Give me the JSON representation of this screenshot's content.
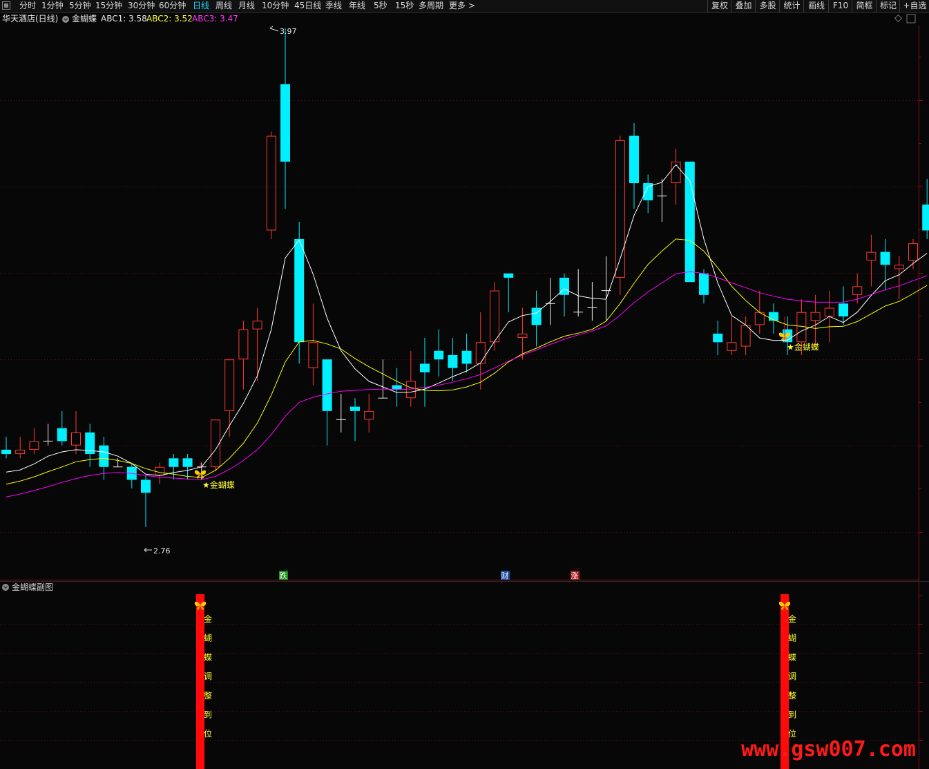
{
  "toolbar": {
    "tabs": [
      "分时",
      "1分钟",
      "5分钟",
      "15分钟",
      "30分钟",
      "60分钟",
      "日线",
      "周线",
      "月线",
      "10分钟",
      "45日线",
      "季线",
      "年线",
      "5秒",
      "15秒",
      "多周期",
      "更多 >"
    ],
    "active_tab": "日线",
    "right_buttons": [
      "复权",
      "叠加",
      "多股",
      "统计",
      "画线",
      "F10",
      "简框",
      "标记",
      "+自选"
    ]
  },
  "info": {
    "stock": "华天酒店(日线)",
    "indicator": "金蝴蝶",
    "abc1": "ABC1: 3.58",
    "abc2": "ABC2: 3.52",
    "abc3": "ABC3: 3.47"
  },
  "colors": {
    "up": "#ff3b30",
    "down": "#00f0ff",
    "abc1": "#ffffff",
    "abc2": "#ffff00",
    "abc3": "#ff00ff",
    "signal": "#ff0a0a",
    "label": "#ffff33",
    "grid": "#5a1010",
    "watermark": "#ff1a1a"
  },
  "chart_data": {
    "type": "candlestick",
    "y_range": [
      2.7,
      4.0
    ],
    "high_label": "3.97",
    "low_label": "2.76",
    "candles": [
      [
        2.99,
        2.98,
        3.02,
        2.97
      ],
      [
        2.98,
        2.99,
        3.02,
        2.97
      ],
      [
        2.99,
        3.01,
        3.04,
        2.98
      ],
      [
        3.01,
        3.01,
        3.05,
        3.0
      ],
      [
        3.04,
        3.01,
        3.08,
        3.0
      ],
      [
        3.0,
        3.03,
        3.08,
        2.98
      ],
      [
        3.03,
        2.98,
        3.05,
        2.95
      ],
      [
        3.0,
        2.95,
        3.02,
        2.92
      ],
      [
        2.95,
        2.95,
        2.97,
        2.95
      ],
      [
        2.95,
        2.92,
        2.96,
        2.9
      ],
      [
        2.92,
        2.89,
        2.93,
        2.81
      ],
      [
        2.93,
        2.95,
        2.96,
        2.91
      ],
      [
        2.97,
        2.95,
        2.98,
        2.92
      ],
      [
        2.97,
        2.95,
        2.98,
        2.92
      ],
      [
        2.95,
        2.95,
        2.96,
        2.92
      ],
      [
        2.95,
        3.06,
        3.06,
        2.94
      ],
      [
        3.08,
        3.2,
        3.2,
        3.02
      ],
      [
        3.2,
        3.27,
        3.29,
        3.13
      ],
      [
        3.27,
        3.29,
        3.32,
        3.15
      ],
      [
        3.5,
        3.72,
        3.73,
        3.48
      ],
      [
        3.84,
        3.66,
        3.97,
        3.55
      ],
      [
        3.48,
        3.24,
        3.52,
        3.19
      ],
      [
        3.18,
        3.24,
        3.33,
        3.14
      ],
      [
        3.2,
        3.08,
        3.2,
        3.0
      ],
      [
        3.06,
        3.06,
        3.12,
        3.03
      ],
      [
        3.09,
        3.08,
        3.11,
        3.01
      ],
      [
        3.06,
        3.08,
        3.12,
        3.03
      ],
      [
        3.11,
        3.11,
        3.2,
        3.12
      ],
      [
        3.14,
        3.13,
        3.18,
        3.09
      ],
      [
        3.11,
        3.15,
        3.22,
        3.09
      ],
      [
        3.19,
        3.17,
        3.25,
        3.09
      ],
      [
        3.22,
        3.2,
        3.27,
        3.16
      ],
      [
        3.21,
        3.18,
        3.25,
        3.15
      ],
      [
        3.22,
        3.19,
        3.26,
        3.17
      ],
      [
        3.19,
        3.24,
        3.31,
        3.13
      ],
      [
        3.24,
        3.36,
        3.38,
        3.22
      ],
      [
        3.4,
        3.39,
        3.33,
        3.31
      ],
      [
        3.25,
        3.26,
        3.32,
        3.2
      ],
      [
        3.32,
        3.28,
        3.36,
        3.23
      ],
      [
        3.33,
        3.33,
        3.39,
        3.28
      ],
      [
        3.39,
        3.35,
        3.4,
        3.3
      ],
      [
        3.31,
        3.31,
        3.41,
        3.3
      ],
      [
        3.32,
        3.32,
        3.38,
        3.29
      ],
      [
        3.36,
        3.36,
        3.44,
        3.29
      ],
      [
        3.39,
        3.71,
        3.72,
        3.35
      ],
      [
        3.72,
        3.61,
        3.75,
        3.55
      ],
      [
        3.61,
        3.57,
        3.63,
        3.54
      ],
      [
        3.58,
        3.58,
        3.62,
        3.52
      ],
      [
        3.61,
        3.66,
        3.69,
        3.56
      ],
      [
        3.66,
        3.38,
        3.66,
        3.42
      ],
      [
        3.4,
        3.35,
        3.41,
        3.33
      ],
      [
        3.26,
        3.24,
        3.29,
        3.21
      ],
      [
        3.22,
        3.24,
        3.3,
        3.21
      ],
      [
        3.23,
        3.28,
        3.3,
        3.21
      ],
      [
        3.28,
        3.31,
        3.36,
        3.26
      ],
      [
        3.31,
        3.29,
        3.33,
        3.26
      ],
      [
        3.27,
        3.24,
        3.3,
        3.21
      ],
      [
        3.24,
        3.31,
        3.34,
        3.21
      ],
      [
        3.29,
        3.31,
        3.35,
        3.23
      ],
      [
        3.3,
        3.32,
        3.36,
        3.24
      ],
      [
        3.33,
        3.3,
        3.37,
        3.28
      ],
      [
        3.35,
        3.37,
        3.4,
        3.33
      ],
      [
        3.43,
        3.45,
        3.49,
        3.37
      ],
      [
        3.45,
        3.42,
        3.48,
        3.36
      ],
      [
        3.41,
        3.42,
        3.44,
        3.34
      ],
      [
        3.43,
        3.47,
        3.48,
        3.41
      ],
      [
        3.56,
        3.5,
        3.62,
        3.48
      ]
    ],
    "ma_series": [
      {
        "name": "ABC1",
        "values": [
          2.938,
          2.943,
          2.957,
          2.975,
          2.985,
          2.99,
          2.988,
          2.985,
          2.975,
          2.958,
          2.933,
          2.93,
          2.937,
          2.942,
          2.95,
          2.99,
          3.046,
          3.098,
          3.162,
          3.27,
          3.436,
          3.478,
          3.398,
          3.296,
          3.22,
          3.178,
          3.149,
          3.136,
          3.123,
          3.124,
          3.131,
          3.145,
          3.16,
          3.173,
          3.192,
          3.242,
          3.287,
          3.302,
          3.308,
          3.335,
          3.364,
          3.348,
          3.342,
          3.34,
          3.434,
          3.535,
          3.602,
          3.612,
          3.653,
          3.615,
          3.48,
          3.378,
          3.302,
          3.28,
          3.25,
          3.244,
          3.245,
          3.266,
          3.28,
          3.3,
          3.286,
          3.31,
          3.349,
          3.383,
          3.397,
          3.423,
          3.447
        ]
      },
      {
        "name": "ABC2",
        "values": [
          2.91,
          2.917,
          2.927,
          2.939,
          2.95,
          2.962,
          2.967,
          2.97,
          2.965,
          2.958,
          2.946,
          2.937,
          2.933,
          2.928,
          2.925,
          2.942,
          2.97,
          3.005,
          3.052,
          3.117,
          3.194,
          3.241,
          3.244,
          3.236,
          3.224,
          3.202,
          3.183,
          3.166,
          3.149,
          3.134,
          3.128,
          3.127,
          3.129,
          3.136,
          3.147,
          3.168,
          3.194,
          3.213,
          3.226,
          3.241,
          3.254,
          3.261,
          3.27,
          3.289,
          3.33,
          3.377,
          3.421,
          3.452,
          3.48,
          3.477,
          3.452,
          3.413,
          3.37,
          3.337,
          3.309,
          3.292,
          3.28,
          3.277,
          3.272,
          3.276,
          3.277,
          3.288,
          3.306,
          3.324,
          3.335,
          3.353,
          3.372
        ]
      },
      {
        "name": "ABC3",
        "values": [
          2.88,
          2.887,
          2.895,
          2.904,
          2.914,
          2.923,
          2.93,
          2.935,
          2.937,
          2.935,
          2.93,
          2.926,
          2.924,
          2.922,
          2.92,
          2.928,
          2.944,
          2.965,
          2.99,
          3.025,
          3.068,
          3.1,
          3.112,
          3.12,
          3.126,
          3.128,
          3.13,
          3.131,
          3.13,
          3.131,
          3.135,
          3.14,
          3.147,
          3.155,
          3.165,
          3.18,
          3.196,
          3.21,
          3.222,
          3.235,
          3.247,
          3.257,
          3.266,
          3.278,
          3.303,
          3.332,
          3.357,
          3.378,
          3.399,
          3.404,
          3.4,
          3.39,
          3.378,
          3.367,
          3.355,
          3.347,
          3.34,
          3.336,
          3.333,
          3.333,
          3.333,
          3.34,
          3.351,
          3.362,
          3.371,
          3.383,
          3.395
        ]
      }
    ],
    "signals": [
      {
        "index": 14,
        "label": "★金蝴蝶"
      },
      {
        "index": 56,
        "label": "★金蝴蝶"
      }
    ],
    "markers": [
      {
        "index": 20,
        "text": "跌",
        "color": "#1a8a1a"
      },
      {
        "index": 36,
        "text": "财",
        "color": "#1a4aa0"
      },
      {
        "index": 41,
        "text": "涨",
        "color": "#a01a1a"
      }
    ]
  },
  "sub_chart": {
    "title": "金蝴蝶副图",
    "bar_text": [
      "金",
      "蝴",
      "蝶",
      "调",
      "整",
      "到",
      "位"
    ]
  },
  "watermark": "www.gsw007.com"
}
